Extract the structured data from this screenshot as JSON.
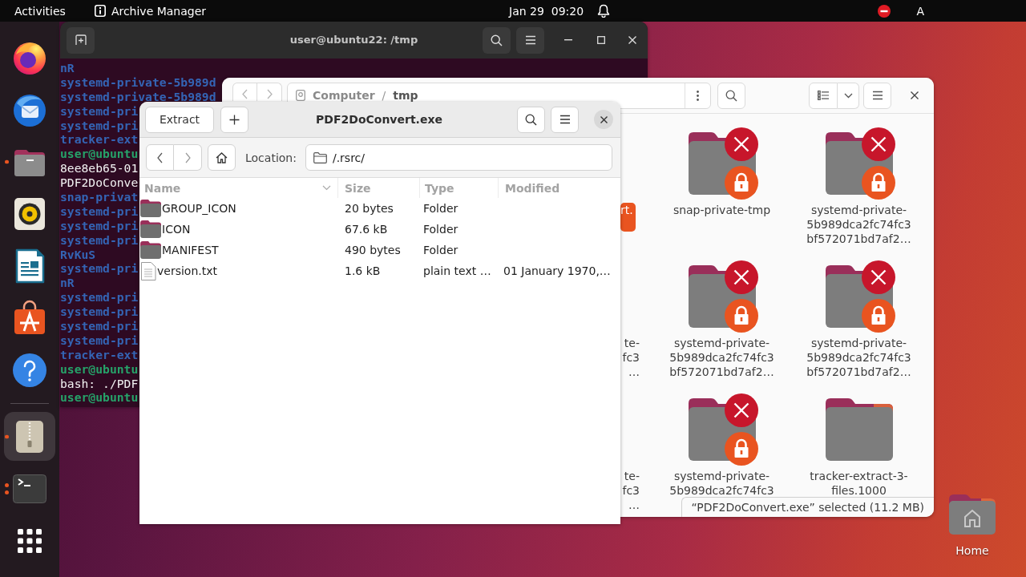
{
  "top_bar": {
    "activities": "Activities",
    "app_name": "Archive Manager",
    "clock": "Jan 29  09:20",
    "input_indicator": "A"
  },
  "dock": {
    "pinned": [
      {
        "kind": "browser",
        "running": false,
        "several_windows": false,
        "selected": false
      },
      {
        "kind": "mail",
        "running": false,
        "several_windows": false,
        "selected": false
      },
      {
        "kind": "files",
        "running": true,
        "several_windows": false,
        "selected": false
      },
      {
        "kind": "music",
        "running": false,
        "several_windows": false,
        "selected": false
      },
      {
        "kind": "writer",
        "running": false,
        "several_windows": false,
        "selected": false
      },
      {
        "kind": "store",
        "running": false,
        "several_windows": false,
        "selected": false
      },
      {
        "kind": "help",
        "running": false,
        "several_windows": false,
        "selected": false
      }
    ],
    "open": [
      {
        "kind": "archive",
        "running": true,
        "several_windows": false,
        "selected": true
      },
      {
        "kind": "terminal",
        "running": true,
        "several_windows": true,
        "selected": false
      }
    ]
  },
  "terminal": {
    "title": "user@ubuntu22: /tmp",
    "lines": [
      {
        "kind": "dir",
        "text": "nR"
      },
      {
        "kind": "dir",
        "text": "systemd-private-5b989d"
      },
      {
        "kind": "dir",
        "text": "systemd-private-5b989d"
      },
      {
        "kind": "dir",
        "text": "systemd-pri"
      },
      {
        "kind": "dir",
        "text": "systemd-pri"
      },
      {
        "kind": "dir",
        "text": "tracker-ext"
      },
      {
        "kind": "prompt",
        "text": "user@ubuntu"
      },
      {
        "kind": "plain",
        "text": "8ee8eb65-01"
      },
      {
        "kind": "plain",
        "text": "PDF2DoConve"
      },
      {
        "kind": "dir",
        "text": "snap-privat"
      },
      {
        "kind": "dir",
        "text": "systemd-pri"
      },
      {
        "kind": "dir",
        "text": "systemd-pri"
      },
      {
        "kind": "dir",
        "text": "systemd-pri"
      },
      {
        "kind": "dir",
        "text": "RvKuS"
      },
      {
        "kind": "dir",
        "text": "systemd-pri"
      },
      {
        "kind": "dir",
        "text": "nR"
      },
      {
        "kind": "dir",
        "text": "systemd-pri"
      },
      {
        "kind": "dir",
        "text": "systemd-pri"
      },
      {
        "kind": "dir",
        "text": "systemd-pri"
      },
      {
        "kind": "dir",
        "text": "systemd-pri"
      },
      {
        "kind": "dir",
        "text": "tracker-ext"
      },
      {
        "kind": "prompt",
        "text": "user@ubuntu"
      },
      {
        "kind": "plain",
        "text": "bash: ./PDF"
      },
      {
        "kind": "prompt",
        "text": "user@ubuntu"
      }
    ]
  },
  "files": {
    "path": {
      "segments": [
        {
          "label": "Computer",
          "current": false
        },
        {
          "label": "tmp",
          "current": true
        }
      ],
      "separator": "/"
    },
    "items": [
      {
        "kind": "partial",
        "label_lines": [
          "rt."
        ],
        "selected": true
      },
      {
        "kind": "folder",
        "label_lines": [
          "snap-private-tmp"
        ],
        "unreadable": true,
        "locked": true,
        "selected": false
      },
      {
        "kind": "folder",
        "label_lines": [
          "systemd-private-",
          "5b989dca2fc74fc3",
          "bf572071bd7af2…"
        ],
        "unreadable": true,
        "locked": true,
        "selected": false
      },
      {
        "kind": "partial",
        "label_lines": [
          "te-",
          "fc3",
          "…"
        ],
        "selected": false
      },
      {
        "kind": "folder",
        "label_lines": [
          "systemd-private-",
          "5b989dca2fc74fc3",
          "bf572071bd7af2…"
        ],
        "unreadable": true,
        "locked": true,
        "selected": false
      },
      {
        "kind": "folder",
        "label_lines": [
          "systemd-private-",
          "5b989dca2fc74fc3",
          "bf572071bd7af2…"
        ],
        "unreadable": true,
        "locked": true,
        "selected": false
      },
      {
        "kind": "partial",
        "label_lines": [
          "te-",
          "fc3",
          "…"
        ],
        "selected": false
      },
      {
        "kind": "folder",
        "label_lines": [
          "systemd-private-",
          "5b989dca2fc74fc3"
        ],
        "unreadable": true,
        "locked": true,
        "selected": false
      },
      {
        "kind": "folder",
        "label_lines": [
          "tracker-extract-3-",
          "files.1000"
        ],
        "unreadable": false,
        "locked": false,
        "selected": false
      }
    ],
    "status": "“PDF2DoConvert.exe” selected (11.2 MB)"
  },
  "archive": {
    "title": "PDF2DoConvert.exe",
    "extract_label": "Extract",
    "location_label": "Location:",
    "location": "/.rsrc/",
    "columns": [
      {
        "label": "Name",
        "sorted": true
      },
      {
        "label": "Size",
        "sorted": false
      },
      {
        "label": "Type",
        "sorted": false
      },
      {
        "label": "Modified",
        "sorted": false
      }
    ],
    "rows": [
      {
        "kind": "folder",
        "name": "GROUP_ICON",
        "size": "20 bytes",
        "type": "Folder"
      },
      {
        "kind": "folder",
        "name": "ICON",
        "size": "67.6 kB",
        "type": "Folder"
      },
      {
        "kind": "folder",
        "name": "MANIFEST",
        "size": "490 bytes",
        "type": "Folder"
      },
      {
        "kind": "text",
        "name": "version.txt",
        "size": "1.6 kB",
        "type": "plain text …",
        "modified": "01 January 1970,…"
      }
    ]
  },
  "desktop": {
    "icons": [
      {
        "label": "Home"
      }
    ]
  }
}
